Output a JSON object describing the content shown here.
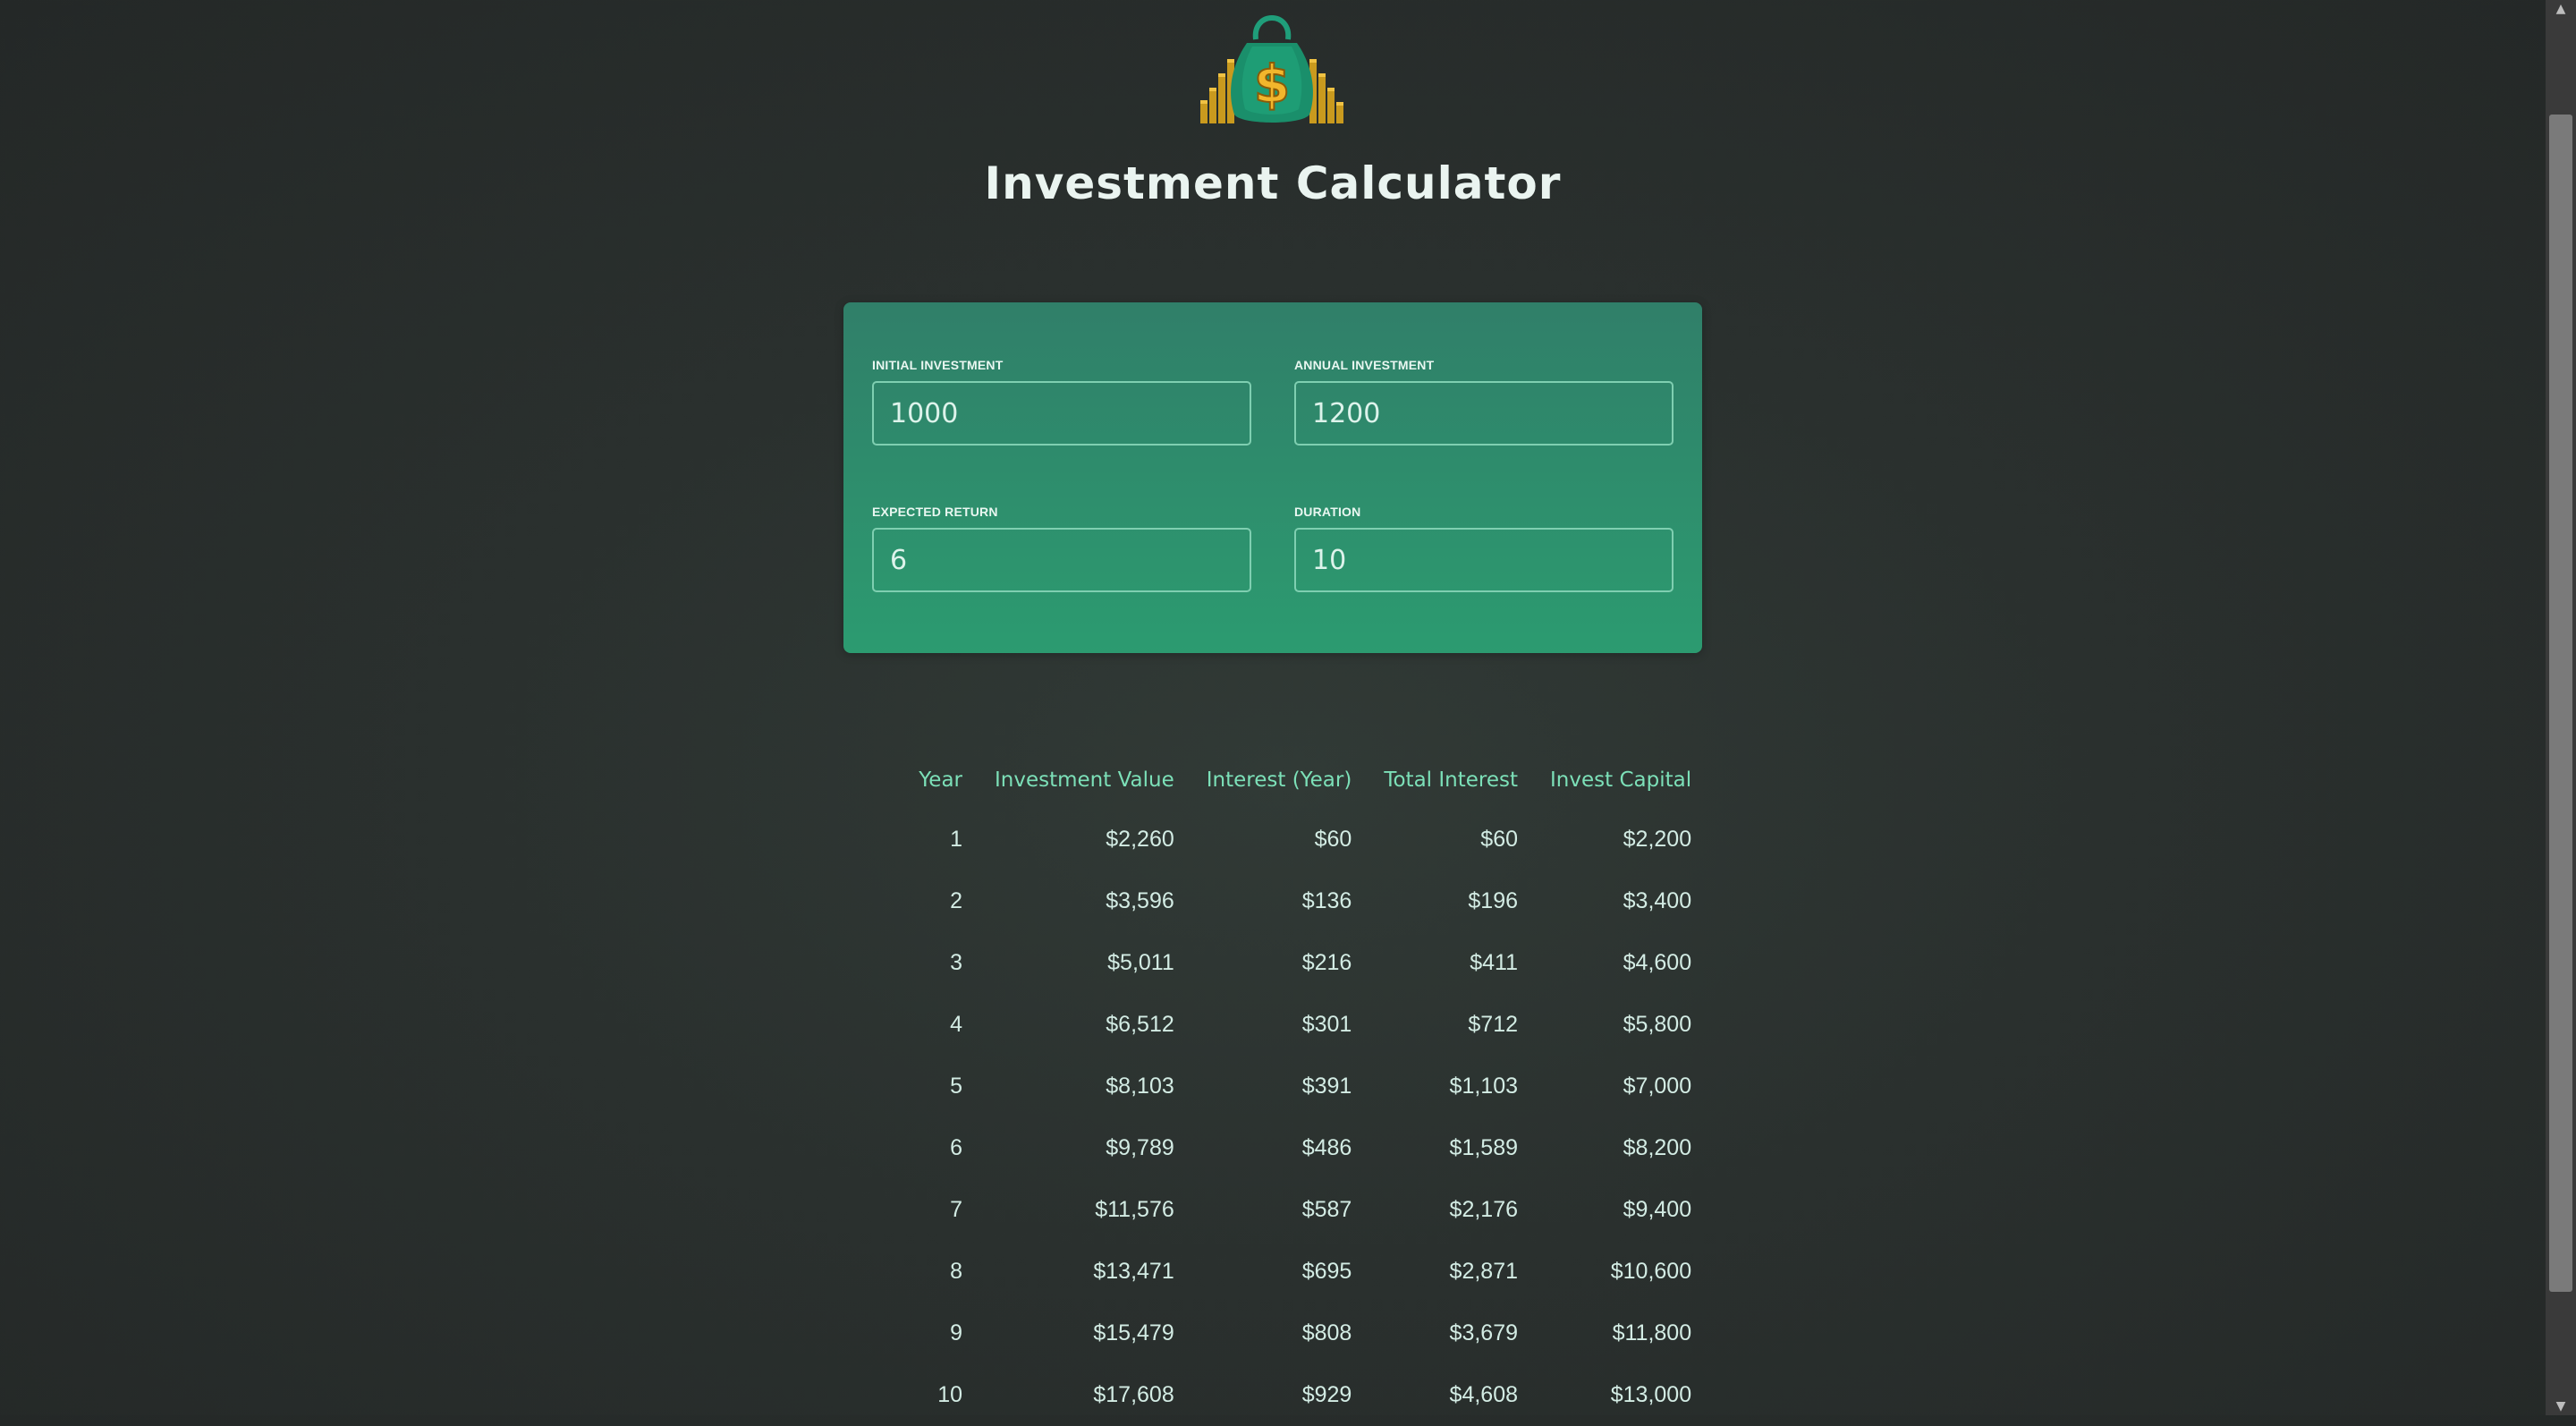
{
  "app": {
    "title": "Investment Calculator",
    "logo_icon": "money-bag-icon",
    "logo_symbol": "$"
  },
  "colors": {
    "background": "#2a302e",
    "panel_top": "#307f69",
    "panel_bottom": "#2c9b70",
    "header_text": "#7ce0b8",
    "body_text": "#d3ece4"
  },
  "inputs": {
    "initial_investment": {
      "label": "Initial Investment",
      "value": "1000"
    },
    "annual_investment": {
      "label": "Annual Investment",
      "value": "1200"
    },
    "expected_return": {
      "label": "Expected Return",
      "value": "6"
    },
    "duration": {
      "label": "Duration",
      "value": "10"
    }
  },
  "results": {
    "headers": [
      "Year",
      "Investment Value",
      "Interest (Year)",
      "Total Interest",
      "Invest Capital"
    ],
    "rows": [
      [
        "1",
        "$2,260",
        "$60",
        "$60",
        "$2,200"
      ],
      [
        "2",
        "$3,596",
        "$136",
        "$196",
        "$3,400"
      ],
      [
        "3",
        "$5,011",
        "$216",
        "$411",
        "$4,600"
      ],
      [
        "4",
        "$6,512",
        "$301",
        "$712",
        "$5,800"
      ],
      [
        "5",
        "$8,103",
        "$391",
        "$1,103",
        "$7,000"
      ],
      [
        "6",
        "$9,789",
        "$486",
        "$1,589",
        "$8,200"
      ],
      [
        "7",
        "$11,576",
        "$587",
        "$2,176",
        "$9,400"
      ],
      [
        "8",
        "$13,471",
        "$695",
        "$2,871",
        "$10,600"
      ],
      [
        "9",
        "$15,479",
        "$808",
        "$3,679",
        "$11,800"
      ],
      [
        "10",
        "$17,608",
        "$929",
        "$4,608",
        "$13,000"
      ]
    ]
  },
  "scrollbar": {
    "up_arrow": "▲",
    "down_arrow": "▼"
  }
}
